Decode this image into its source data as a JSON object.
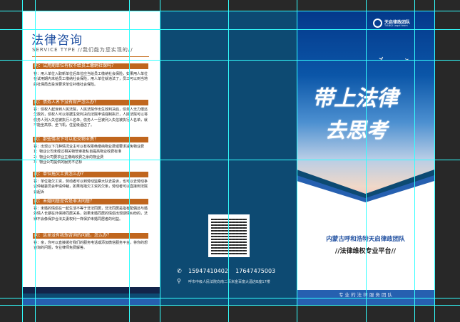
{
  "left_panel": {
    "title": "法律咨询",
    "subtitle": "SERVICE TYPE  //我们能为您实现的//",
    "qa": [
      {
        "q": "问：试用期单位有权不给员工缴纳社保吗？",
        "a": "答：用人单位入职新单位后单位应当给员工缴纳社会保险，如果用人单位在试用期内未给员工缴纳社会保险，用人单位就违法了，员工可以到当地的社保局去投诉要求单位补缴社会保险。"
      },
      {
        "q": "问：债务人名下没有财产怎么办？",
        "a": "答：债权人起诉到人民法院，人民法院作出生效判决后，债务人无力偿还欠款的，债权人可以依据生效判决向法院申请强制执行，人民法院可以将债务人列入失信被执行人名单，债务人一旦被列入失信被执行人名单，就不能坐高铁、坐飞机，住星级酒店了。"
      },
      {
        "q": "问：那些情况下可以拒交物业费？",
        "a": "答：出现以下几种情况业主可以有权拒绝缴纳物业费或要求减免物业费\n 1：物业公司未经过相关物管审批私自提高物业收费标准\n 2：物业公司要求业主缴纳收费之余的物业费\n 3：物业公司提供的服务不达标"
      },
      {
        "q": "问：单位拖欠工资怎么办？",
        "a": "答：单位拖欠工资，劳动者可以到劳动监察大队去投诉，也可以去劳动争议仲裁委员会申请仲裁，如果有拖欠工资的欠条，劳动者可以直接到法院去起诉"
      },
      {
        "q": "问：未婚同居是否是非法同居？",
        "a": "答：未婚的情侣在一起生活不等于非法同居，非法同居是指有配偶还与婚外情人长期在外保持同居关系，如果未婚同居的情侣出现感情纠纷的，法律不会像保护合法夫妻权利一样保护未婚同居者的利益。"
      },
      {
        "q": "问：这里没有我想咨询的问题，怎么办？",
        "a": "答：亲，你可以直接拨打我们的服务电话或添加微信服务平台，将你的想咨询的问题，专业律师免费解答。"
      }
    ]
  },
  "middle_panel": {
    "phone_icon": "phone-icon",
    "phones": "15947410402    17647475003",
    "location_icon": "map-pin-icon",
    "address": "呼市中级人民法院向南二百米金百富大酒店B座17楼"
  },
  "right_panel": {
    "logo_text": "天启律政团队",
    "logo_sub": "TIANQI  Legal team",
    "slogan_line1": "带上法律",
    "slogan_line2": "去思考",
    "team_name": "内蒙古呼和浩特天启律政团队",
    "platform": "//法律维权专业平台//",
    "footer": "专 业 的 法 律 服 务 团 队"
  },
  "colors": {
    "orange": "#c0661e",
    "navy": "#0d4a72",
    "blue": "#1f4fa0",
    "bg": "#282828",
    "guide": "#00ffff"
  }
}
